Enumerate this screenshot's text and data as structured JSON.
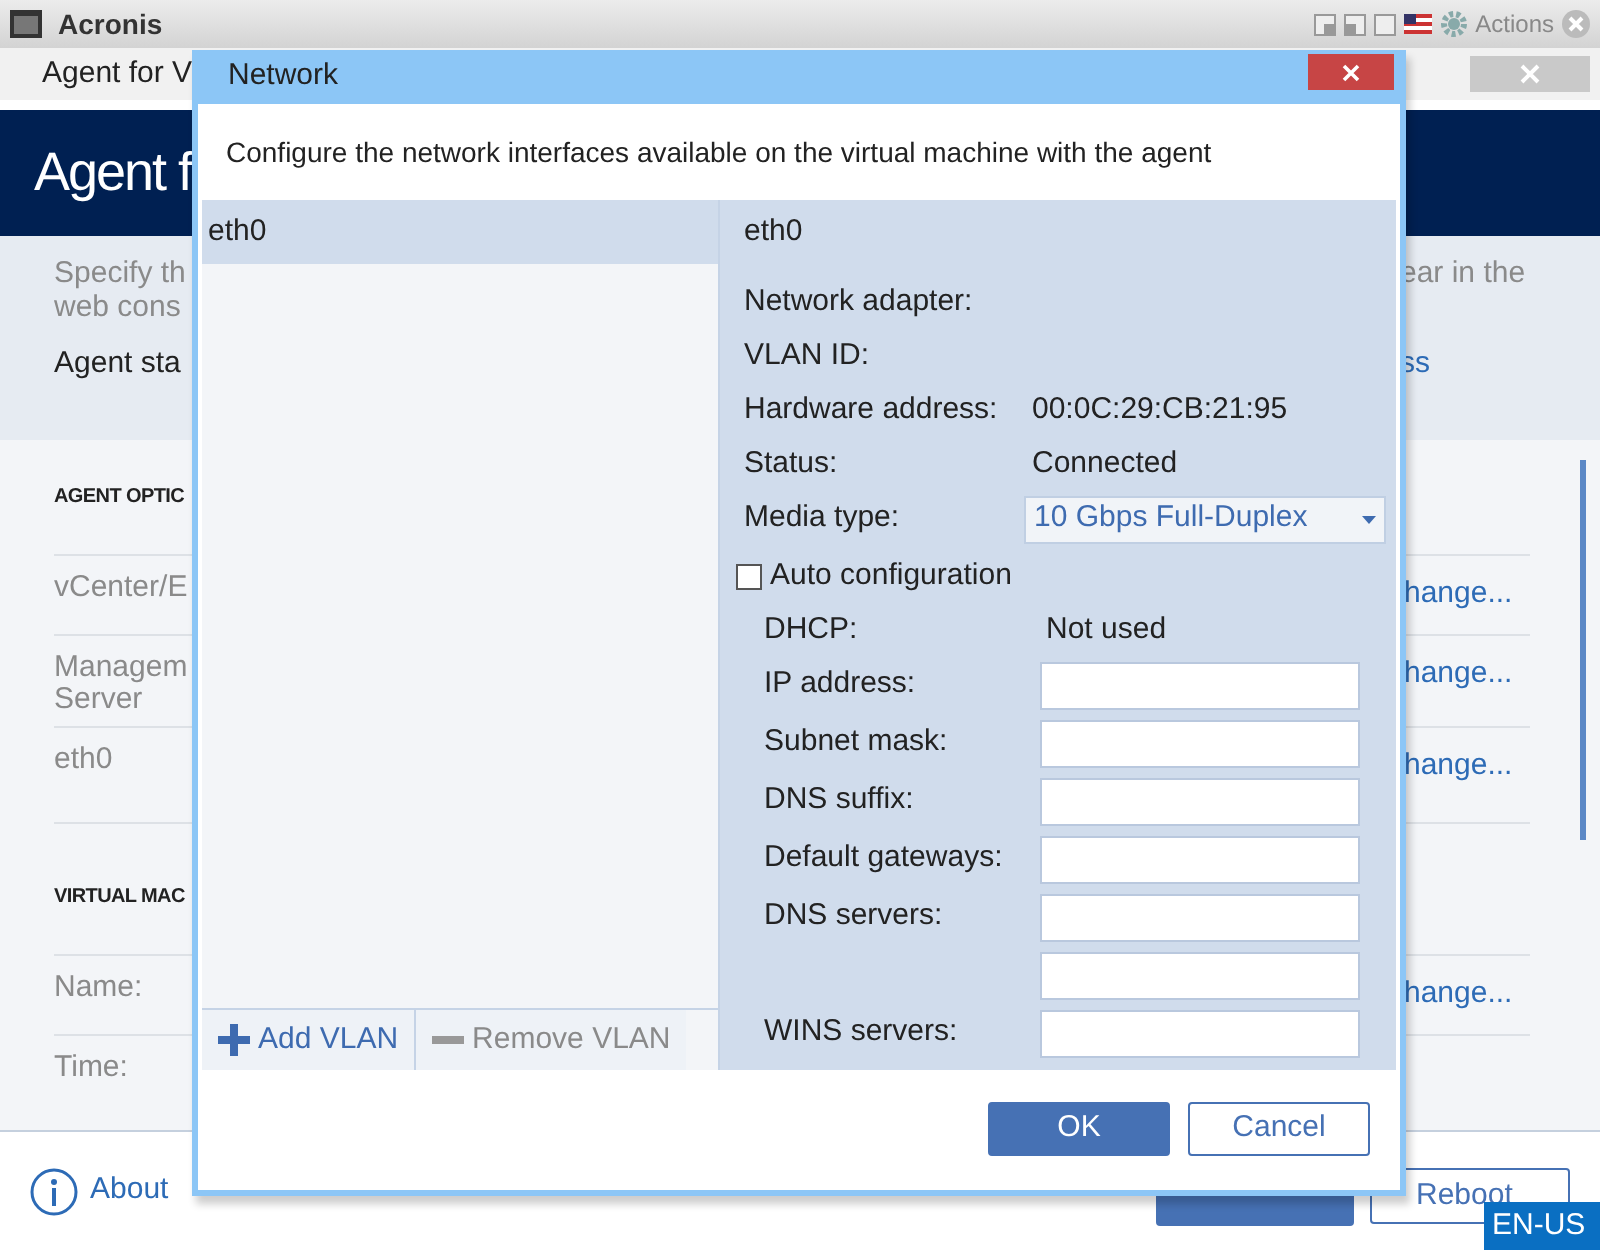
{
  "app": {
    "title": "Acronis",
    "actions": "Actions"
  },
  "tab": {
    "label": "Agent for V"
  },
  "header": {
    "title": "Agent f"
  },
  "intro": {
    "lines_left": [
      "Specify th",
      "web cons"
    ],
    "text_right": "ear in the",
    "status_left": "Agent sta",
    "status_link": "ss"
  },
  "sections": [
    {
      "heading": "AGENT OPTIC",
      "rows": [
        {
          "label_lines": [
            "vCenter/E"
          ],
          "action": "hange..."
        },
        {
          "label_lines": [
            "Managem",
            "Server"
          ],
          "action": "hange..."
        },
        {
          "label_lines": [
            "eth0"
          ],
          "action": "hange..."
        }
      ]
    },
    {
      "heading": "VIRTUAL MAC",
      "rows": [
        {
          "label_lines": [
            "Name:"
          ],
          "action": "hange..."
        },
        {
          "label_lines": [
            "Time:"
          ]
        }
      ]
    }
  ],
  "footer": {
    "about": "About",
    "reboot": "Reboot",
    "language": "EN-US"
  },
  "dialog": {
    "title": "Network",
    "description": "Configure the network interfaces available on the virtual machine with the agent",
    "interfaces": [
      {
        "name": "eth0",
        "selected": true
      }
    ],
    "list_buttons": [
      {
        "kind": "add",
        "label": "Add VLAN",
        "disabled": false
      },
      {
        "kind": "remove",
        "label": "Remove VLAN",
        "disabled": true
      }
    ],
    "details": {
      "heading": "eth0",
      "fields": [
        {
          "kind": "text",
          "label": "Network adapter:"
        },
        {
          "kind": "text",
          "label": "VLAN ID:"
        },
        {
          "kind": "text",
          "label": "Hardware address:",
          "value": "00:0C:29:CB:21:95"
        },
        {
          "kind": "text",
          "label": "Status:",
          "value": "Connected"
        },
        {
          "kind": "select",
          "label": "Media type:",
          "value": "10 Gbps Full-Duplex"
        }
      ],
      "auto_configuration": {
        "label": "Auto configuration",
        "checked": false
      },
      "ip_fields": [
        {
          "kind": "text",
          "label": "DHCP:",
          "value": "Not used"
        },
        {
          "kind": "input",
          "label": "IP address:"
        },
        {
          "kind": "input",
          "label": "Subnet mask:"
        },
        {
          "kind": "input",
          "label": "DNS suffix:"
        },
        {
          "kind": "input",
          "label": "Default gateways:"
        },
        {
          "kind": "input",
          "label": "DNS servers:"
        },
        {
          "kind": "input"
        },
        {
          "kind": "input",
          "label": "WINS servers:"
        }
      ]
    },
    "buttons": [
      {
        "kind": "primary",
        "label": "OK"
      },
      {
        "kind": "secondary",
        "label": "Cancel"
      }
    ]
  }
}
